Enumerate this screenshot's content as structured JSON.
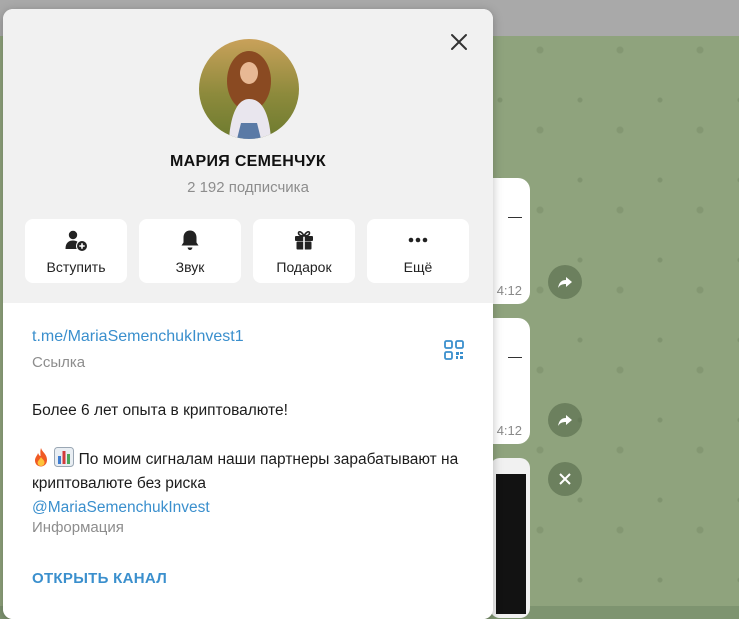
{
  "profile": {
    "name": "МАРИЯ СЕМЕНЧУК",
    "subscribers": "2 192 подписчика"
  },
  "actions": [
    {
      "label": "Вступить",
      "icon": "user-add-icon"
    },
    {
      "label": "Звук",
      "icon": "bell-icon"
    },
    {
      "label": "Подарок",
      "icon": "gift-icon"
    },
    {
      "label": "Ещё",
      "icon": "more-dots-icon"
    }
  ],
  "info": {
    "link": "t.me/MariaSemenchukInvest1",
    "link_caption": "Ссылка",
    "description_line1": "Более 6 лет опыта в криптовалюте!",
    "description_line2": "По моим сигналам наши партнеры зарабатывают на криптовалюте без риска",
    "mention": "@MariaSemenchukInvest",
    "info_caption": "Информация",
    "open_channel": "ОТКРЫТЬ КАНАЛ"
  },
  "background": {
    "bubble_time_1": "4:12",
    "bubble_time_2": "4:12"
  },
  "colors": {
    "accent": "#3a8fcd",
    "header_bg": "#f1f1f1",
    "chat_bg": "#8fa37d"
  }
}
